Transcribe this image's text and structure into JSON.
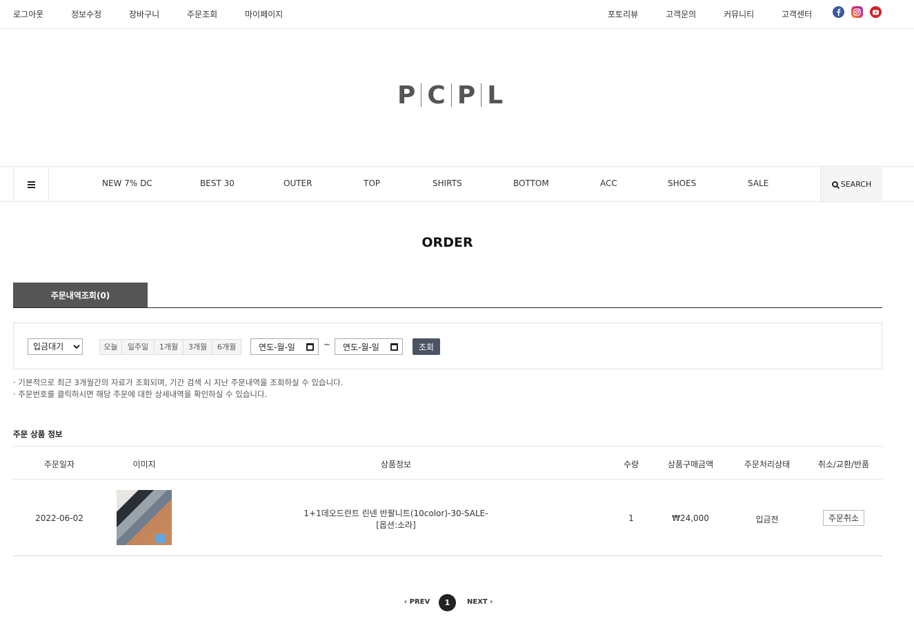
{
  "topbar": {
    "left_links": [
      "로그아웃",
      "정보수정",
      "장바구니",
      "주문조회",
      "마이페이지"
    ],
    "right_links": [
      "포토리뷰",
      "고객문의",
      "커뮤니티",
      "고객센터"
    ],
    "social": [
      "facebook-icon",
      "instagram-icon",
      "youtube-icon"
    ]
  },
  "logo": {
    "letters": [
      "P",
      "C",
      "P",
      "L"
    ]
  },
  "nav": {
    "items": [
      "NEW 7% DC",
      "BEST 30",
      "OUTER",
      "TOP",
      "SHIRTS",
      "BOTTOM",
      "ACC",
      "SHOES",
      "SALE"
    ],
    "search_label": "SEARCH"
  },
  "page_title": "ORDER",
  "tab": {
    "label": "주문내역조회(0)"
  },
  "filter": {
    "status_selected": "입금대기",
    "periods": [
      "오늘",
      "일주일",
      "1개월",
      "3개월",
      "6개월"
    ],
    "date_from_placeholder": "연도-월-일",
    "date_to_placeholder": "연도-월-일",
    "tilde": "~",
    "search_button": "조회"
  },
  "notes": [
    "· 기본적으로 최근 3개월간의 자료가 조회되며, 기간 검색 시 지난 주문내역을 조회하실 수 있습니다.",
    "· 주문번호를 클릭하시면 해당 주문에 대한 상세내역을 확인하실 수 있습니다."
  ],
  "section_title": "주문 상품 정보",
  "table": {
    "headers": [
      "주문일자",
      "이미지",
      "상품정보",
      "수량",
      "상품구매금액",
      "주문처리상태",
      "취소/교환/반품"
    ],
    "rows": [
      {
        "date": "2022-06-02",
        "product_line1": "1+1데오드란트 린넨 반팔니트(10color)-30-SALE-",
        "product_line2": "[옵션:소라]",
        "qty": "1",
        "price": "₩24,000",
        "status": "입금전",
        "action": "주문취소"
      }
    ]
  },
  "pager": {
    "prev": "PREV",
    "current": "1",
    "next": "NEXT"
  },
  "colors": {
    "tab_bg": "#555555",
    "search_btn": "#4a5462",
    "pager_active": "#222222"
  }
}
